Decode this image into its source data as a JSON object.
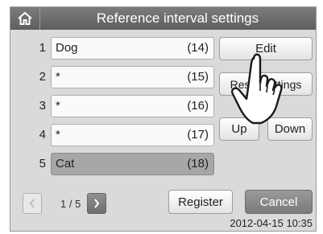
{
  "header": {
    "title": "Reference interval settings",
    "home_icon": "home-icon"
  },
  "rows": [
    {
      "num": "1",
      "name": "Dog",
      "count": "(14)",
      "selected": false
    },
    {
      "num": "2",
      "name": "*",
      "count": "(15)",
      "selected": false
    },
    {
      "num": "3",
      "name": "*",
      "count": "(16)",
      "selected": false
    },
    {
      "num": "4",
      "name": "*",
      "count": "(17)",
      "selected": false
    },
    {
      "num": "5",
      "name": "Cat",
      "count": "(18)",
      "selected": true
    }
  ],
  "actions": {
    "edit": "Edit",
    "reset": "Reset settings",
    "up": "Up",
    "down": "Down",
    "register": "Register",
    "cancel": "Cancel"
  },
  "pagination": {
    "text": "1 / 5",
    "prev_icon": "chevron-left-icon",
    "next_icon": "chevron-right-icon"
  },
  "status": {
    "datetime": "2012-04-15 10:35"
  }
}
